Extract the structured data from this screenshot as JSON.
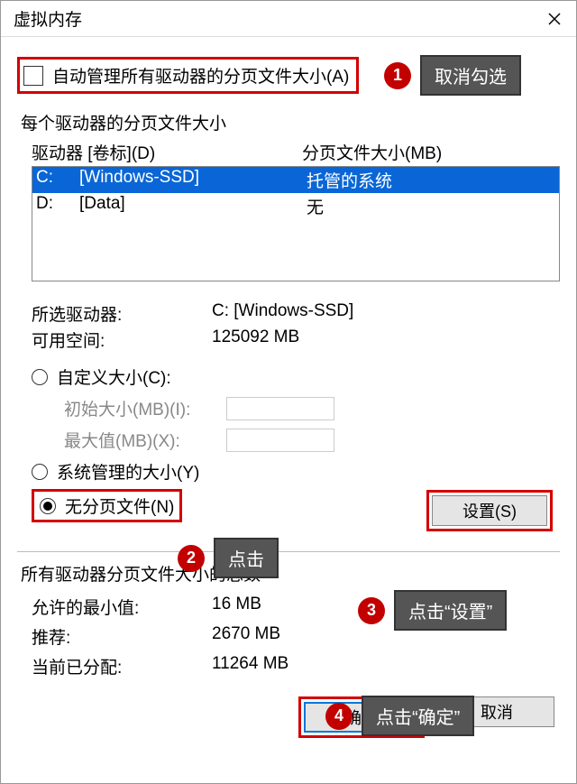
{
  "window": {
    "title": "虚拟内存"
  },
  "autoManage": {
    "label": "自动管理所有驱动器的分页文件大小(A)",
    "checked": false
  },
  "driveSection": {
    "heading": "每个驱动器的分页文件大小",
    "col1": "驱动器 [卷标](D)",
    "col2": "分页文件大小(MB)",
    "rows": [
      {
        "letter": "C:",
        "label": "[Windows-SSD]",
        "size": "托管的系统",
        "selected": true
      },
      {
        "letter": "D:",
        "label": "[Data]",
        "size": "无",
        "selected": false
      }
    ]
  },
  "selectedInfo": {
    "driveLabel": "所选驱动器:",
    "driveValue": "C:  [Windows-SSD]",
    "freeLabel": "可用空间:",
    "freeValue": "125092 MB"
  },
  "sizeOptions": {
    "custom": "自定义大小(C):",
    "initialLabel": "初始大小(MB)(I):",
    "maxLabel": "最大值(MB)(X):",
    "systemManaged": "系统管理的大小(Y)",
    "noPaging": "无分页文件(N)",
    "selected": "noPaging"
  },
  "setButton": "设置(S)",
  "totals": {
    "heading": "所有驱动器分页文件大小的总数",
    "rows": [
      {
        "key": "允许的最小值:",
        "val": "16 MB"
      },
      {
        "key": "推荐:",
        "val": "2670 MB"
      },
      {
        "key": "当前已分配:",
        "val": "11264 MB"
      }
    ]
  },
  "buttons": {
    "ok": "确定",
    "cancel": "取消"
  },
  "annotations": {
    "a1": {
      "num": "1",
      "text": "取消勾选"
    },
    "a2": {
      "num": "2",
      "text": "点击"
    },
    "a3": {
      "num": "3",
      "text": "点击“设置”"
    },
    "a4": {
      "num": "4",
      "text": "点击“确定”"
    }
  }
}
